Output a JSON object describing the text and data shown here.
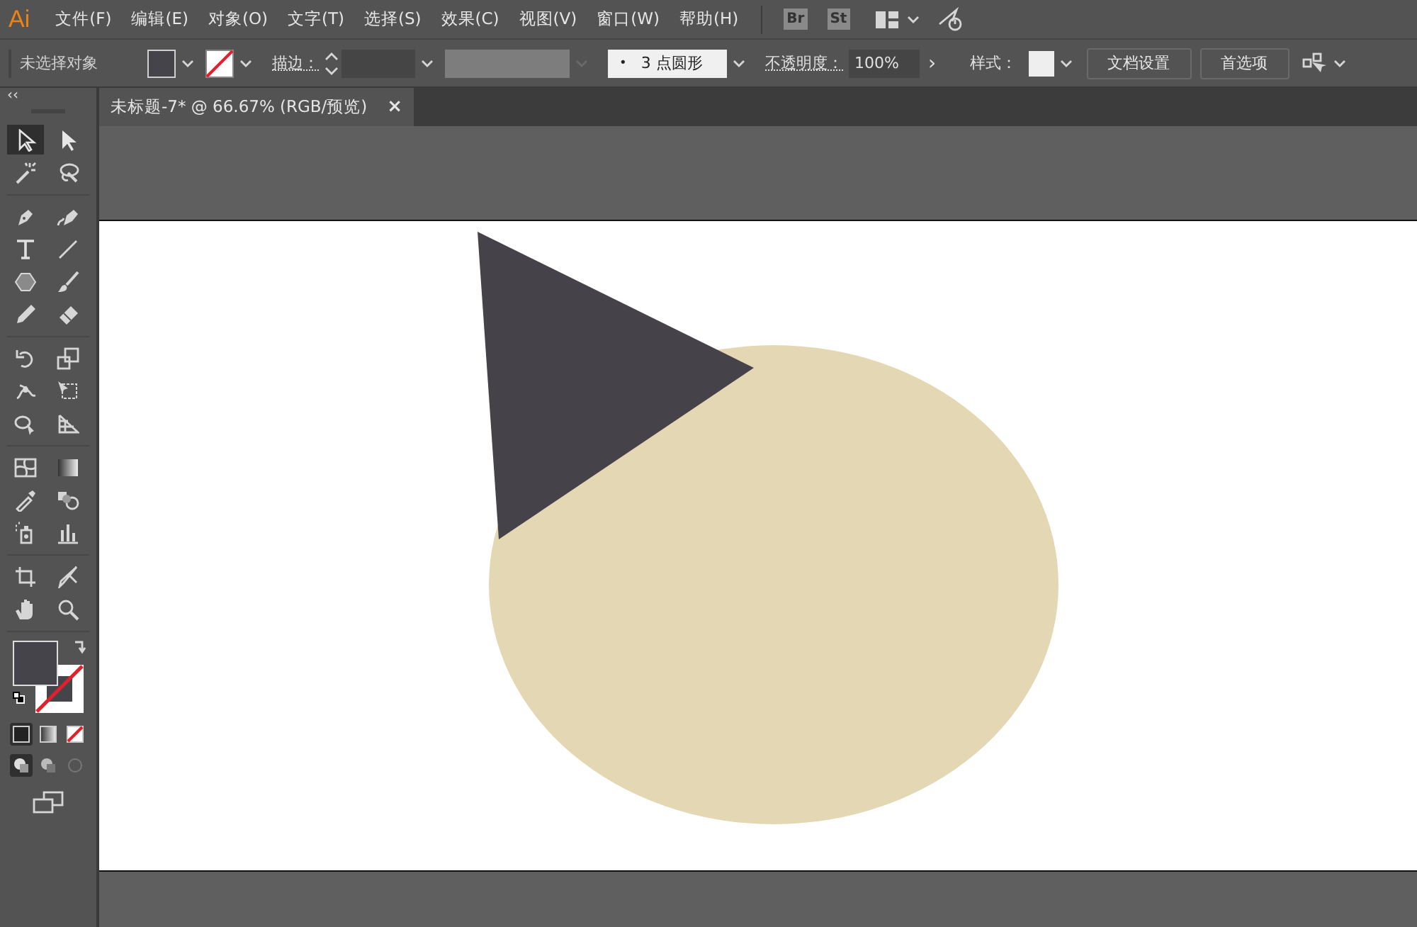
{
  "app": {
    "logo": "Ai"
  },
  "menu": [
    {
      "label": "文件(F)"
    },
    {
      "label": "编辑(E)"
    },
    {
      "label": "对象(O)"
    },
    {
      "label": "文字(T)"
    },
    {
      "label": "选择(S)"
    },
    {
      "label": "效果(C)"
    },
    {
      "label": "视图(V)"
    },
    {
      "label": "窗口(W)"
    },
    {
      "label": "帮助(H)"
    }
  ],
  "menu_apps": [
    "Br",
    "St"
  ],
  "control_bar": {
    "selection": "未选择对象",
    "fill": {
      "color": "#46444b"
    },
    "stroke": {
      "kind": "none"
    },
    "stroke_label": "描边：",
    "brush_bullet": "•",
    "brush": "3 点圆形",
    "opacity_label": "不透明度：",
    "opacity": "100%",
    "opacity_arrow": "›",
    "style_label": "样式：",
    "buttons": [
      "文档设置",
      "首选项"
    ]
  },
  "panel_collapse": "‹‹",
  "document_tab": {
    "title": "未标题-7* @ 66.67% (RGB/预览)",
    "close": "×",
    "selected": true
  },
  "tool_groups": [
    [
      {
        "kind": "selection",
        "selected": true
      },
      {
        "kind": "direct",
        "selected": false
      },
      {
        "kind": "wand",
        "selected": false
      },
      {
        "kind": "lasso",
        "selected": false
      }
    ],
    [
      {
        "kind": "pen",
        "selected": false
      },
      {
        "kind": "curvature",
        "selected": false
      },
      {
        "kind": "type",
        "selected": false
      },
      {
        "kind": "line",
        "selected": false
      },
      {
        "kind": "polygon",
        "selected": false
      },
      {
        "kind": "brush",
        "selected": false
      },
      {
        "kind": "pencil",
        "selected": false
      },
      {
        "kind": "eraser",
        "selected": false
      }
    ],
    [
      {
        "kind": "rotate",
        "selected": false
      },
      {
        "kind": "scale",
        "selected": false
      },
      {
        "kind": "warp",
        "selected": false
      },
      {
        "kind": "transform",
        "selected": false
      },
      {
        "kind": "shapebuilder",
        "selected": false
      },
      {
        "kind": "perspective",
        "selected": false
      }
    ],
    [
      {
        "kind": "mesh",
        "selected": false
      },
      {
        "kind": "gradient",
        "selected": false
      },
      {
        "kind": "eyedropper",
        "selected": false
      },
      {
        "kind": "blend",
        "selected": false
      },
      {
        "kind": "symbol",
        "selected": false
      },
      {
        "kind": "graph",
        "selected": false
      }
    ],
    [
      {
        "kind": "artboard",
        "selected": false
      },
      {
        "kind": "slice",
        "selected": false
      },
      {
        "kind": "hand",
        "selected": false
      },
      {
        "kind": "zoom",
        "selected": false
      }
    ]
  ],
  "fill_stroke": {
    "fill": {
      "color": "#46444b"
    },
    "stroke": {
      "kind": "none"
    }
  },
  "color_modes": [
    {
      "kind": "color",
      "selected": true
    },
    {
      "kind": "gradient",
      "selected": false
    },
    {
      "kind": "none",
      "selected": false
    }
  ],
  "draw_modes": [
    {
      "kind": "normal",
      "selected": true
    },
    {
      "kind": "behind",
      "selected": false
    },
    {
      "kind": "inside",
      "selected": false
    }
  ],
  "artwork": [
    {
      "kind": "ellipse",
      "color": "#e4d8b4"
    },
    {
      "kind": "triangle",
      "color": "#45424a"
    }
  ]
}
